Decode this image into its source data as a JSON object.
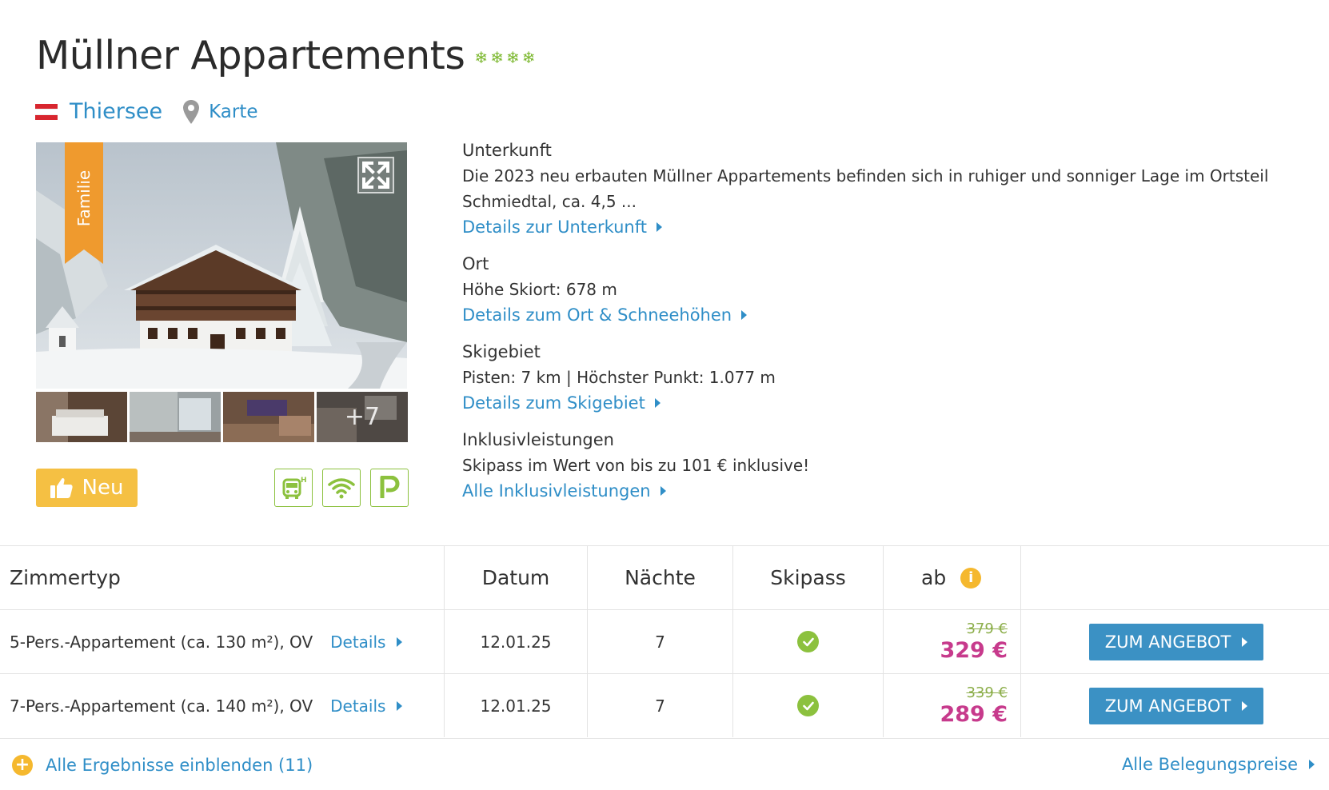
{
  "hotel": {
    "name": "Müllner Appartements",
    "stars": [
      "❄",
      "❄",
      "❄",
      "❄"
    ],
    "location": "Thiersee",
    "map_label": "Karte",
    "badge": "Familie",
    "more_photos": "+7",
    "neu_label": "Neu"
  },
  "amenities": [
    "bus-shuttle-icon",
    "wifi-icon",
    "parking-icon"
  ],
  "info": [
    {
      "heading": "Unterkunft",
      "text": "Die 2023 neu erbauten Müllner Appartements befinden sich in ruhiger und sonniger Lage im Ortsteil Schmiedtal, ca. 4,5 ...",
      "link": "Details zur Unterkunft"
    },
    {
      "heading": "Ort",
      "text": "Höhe Skiort: 678 m",
      "link": "Details zum Ort & Schneehöhen"
    },
    {
      "heading": "Skigebiet",
      "text": "Pisten: 7 km | Höchster Punkt: 1.077 m",
      "link": "Details zum Skigebiet"
    },
    {
      "heading": "Inklusivleistungen",
      "text": "Skipass im Wert von bis zu 101 € inklusive!",
      "link": "Alle Inklusivleistungen"
    }
  ],
  "table": {
    "headers": {
      "room": "Zimmertyp",
      "date": "Datum",
      "nights": "Nächte",
      "skipass": "Skipass",
      "price": "ab"
    },
    "rows": [
      {
        "room": "5-Pers.-Appartement (ca. 130 m²), OV",
        "details": "Details",
        "date": "12.01.25",
        "nights": "7",
        "old_price": "379 €",
        "price": "329 €",
        "button": "ZUM ANGEBOT"
      },
      {
        "room": "7-Pers.-Appartement (ca. 140 m²), OV",
        "details": "Details",
        "date": "12.01.25",
        "nights": "7",
        "old_price": "339 €",
        "price": "289 €",
        "button": "ZUM ANGEBOT"
      }
    ]
  },
  "footer": {
    "show_all": "Alle Ergebnisse einblenden (11)",
    "all_prices": "Alle Belegungspreise"
  },
  "colors": {
    "link": "#2f8ec7",
    "accent_green": "#8cc13e",
    "price": "#c73a8c",
    "button": "#3b91c4",
    "badge": "#f5c043",
    "ribbon": "#ef9a2e"
  }
}
